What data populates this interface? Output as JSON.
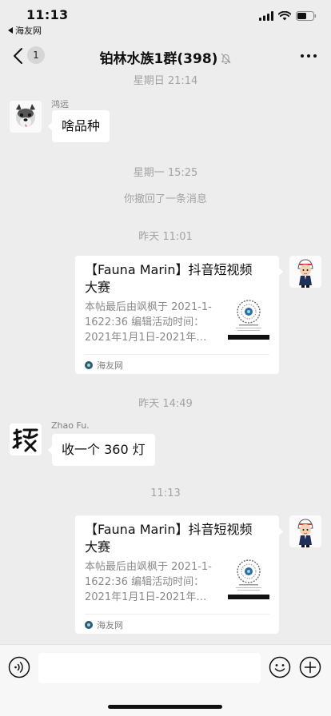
{
  "status_bar": {
    "time": "11:13",
    "back_app": "海友网",
    "icons": [
      "signal-icon",
      "wifi-icon",
      "battery-icon"
    ]
  },
  "nav": {
    "back_icon": "chevron-left-icon",
    "unread_badge": "1",
    "title": "铂林水族1群(398)",
    "mute_icon": "bell-off-icon",
    "more_icon": "more-dots-icon"
  },
  "chat": {
    "sep1": "星期日 21:14",
    "msg1": {
      "sender": "鸿远",
      "text": "啥品种"
    },
    "sep2": "星期一 15:25",
    "recall_notice": "你撤回了一条消息",
    "sep3": "昨天 11:01",
    "card1": {
      "title": "【Fauna Marin】抖音短视频大赛",
      "desc": "本帖最后由飒枫于 2021-1-1622:36 编辑活动时间：2021年1月1日-2021年…",
      "source": "海友网"
    },
    "sep4": "昨天 14:49",
    "msg2": {
      "sender": "Zhao Fu.",
      "text": "收一个 360 灯"
    },
    "sep5": "11:13",
    "card2": {
      "title": "【Fauna Marin】抖音短视频大赛",
      "desc": "本帖最后由飒枫于 2021-1-1622:36 编辑活动时间：2021年1月1日-2021年…",
      "source": "海友网"
    }
  },
  "input_bar": {
    "voice_icon": "voice-icon",
    "emoji_icon": "emoji-icon",
    "plus_icon": "plus-circle-icon",
    "input_value": ""
  }
}
